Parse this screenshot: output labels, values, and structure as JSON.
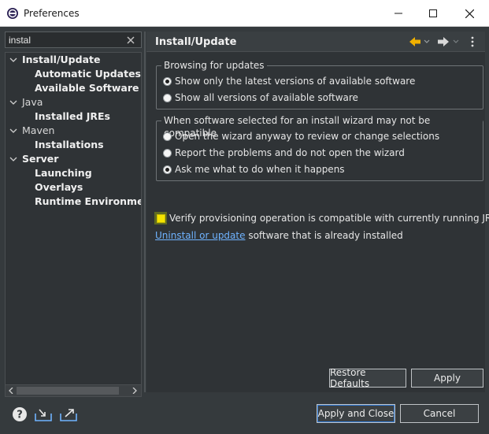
{
  "window": {
    "title": "Preferences",
    "icons": {
      "app": "eclipse-icon",
      "minimize": "minimize-icon",
      "maximize": "maximize-icon",
      "close": "close-icon"
    }
  },
  "filter": {
    "value": "instal",
    "clear_icon": "clear-icon"
  },
  "tree": {
    "nodes": [
      {
        "label": "Install/Update",
        "level": 0,
        "expanded": true,
        "bold": true
      },
      {
        "label": "Automatic Updates",
        "level": 1,
        "bold": true
      },
      {
        "label": "Available Software Sites",
        "level": 1,
        "bold": true
      },
      {
        "label": "Java",
        "level": 0,
        "expanded": true,
        "bold": false
      },
      {
        "label": "Installed JREs",
        "level": 1,
        "bold": true
      },
      {
        "label": "Maven",
        "level": 0,
        "expanded": true,
        "bold": false
      },
      {
        "label": "Installations",
        "level": 1,
        "bold": true
      },
      {
        "label": "Server",
        "level": 0,
        "expanded": true,
        "bold": true
      },
      {
        "label": "Launching",
        "level": 1,
        "bold": true
      },
      {
        "label": "Overlays",
        "level": 1,
        "bold": true
      },
      {
        "label": "Runtime Environments",
        "level": 1,
        "bold": true
      }
    ]
  },
  "page": {
    "title": "Install/Update",
    "nav": {
      "back_icon": "back-arrow-icon",
      "forward_icon": "forward-arrow-icon",
      "menu_icon": "view-menu-icon"
    },
    "browsing_group": {
      "legend": "Browsing for updates",
      "options": [
        {
          "label": "Show only the latest versions of available software",
          "checked": true
        },
        {
          "label": "Show all versions of available software",
          "checked": false
        }
      ]
    },
    "compat_group": {
      "legend": "When software selected for an install wizard may not be compatible",
      "options": [
        {
          "label": "Open the wizard anyway to review or change selections",
          "checked": false
        },
        {
          "label": "Report the problems and do not open the wizard",
          "checked": false
        },
        {
          "label": "Ask me what to do when it happens",
          "checked": true
        }
      ]
    },
    "verify_checkbox": {
      "label": "Verify provisioning operation is compatible with currently running JRE",
      "checked": false
    },
    "uninstall": {
      "link": "Uninstall or update",
      "text": " software that is already installed"
    },
    "restore_defaults": "Restore Defaults",
    "apply": "Apply"
  },
  "footer": {
    "help_icon": "help-icon",
    "import_icon": "import-icon",
    "export_icon": "export-icon",
    "apply_close": "Apply and Close",
    "cancel": "Cancel"
  },
  "colors": {
    "link": "#6fb3ff",
    "background": "#353a3d",
    "highlight": "#f5e400"
  }
}
